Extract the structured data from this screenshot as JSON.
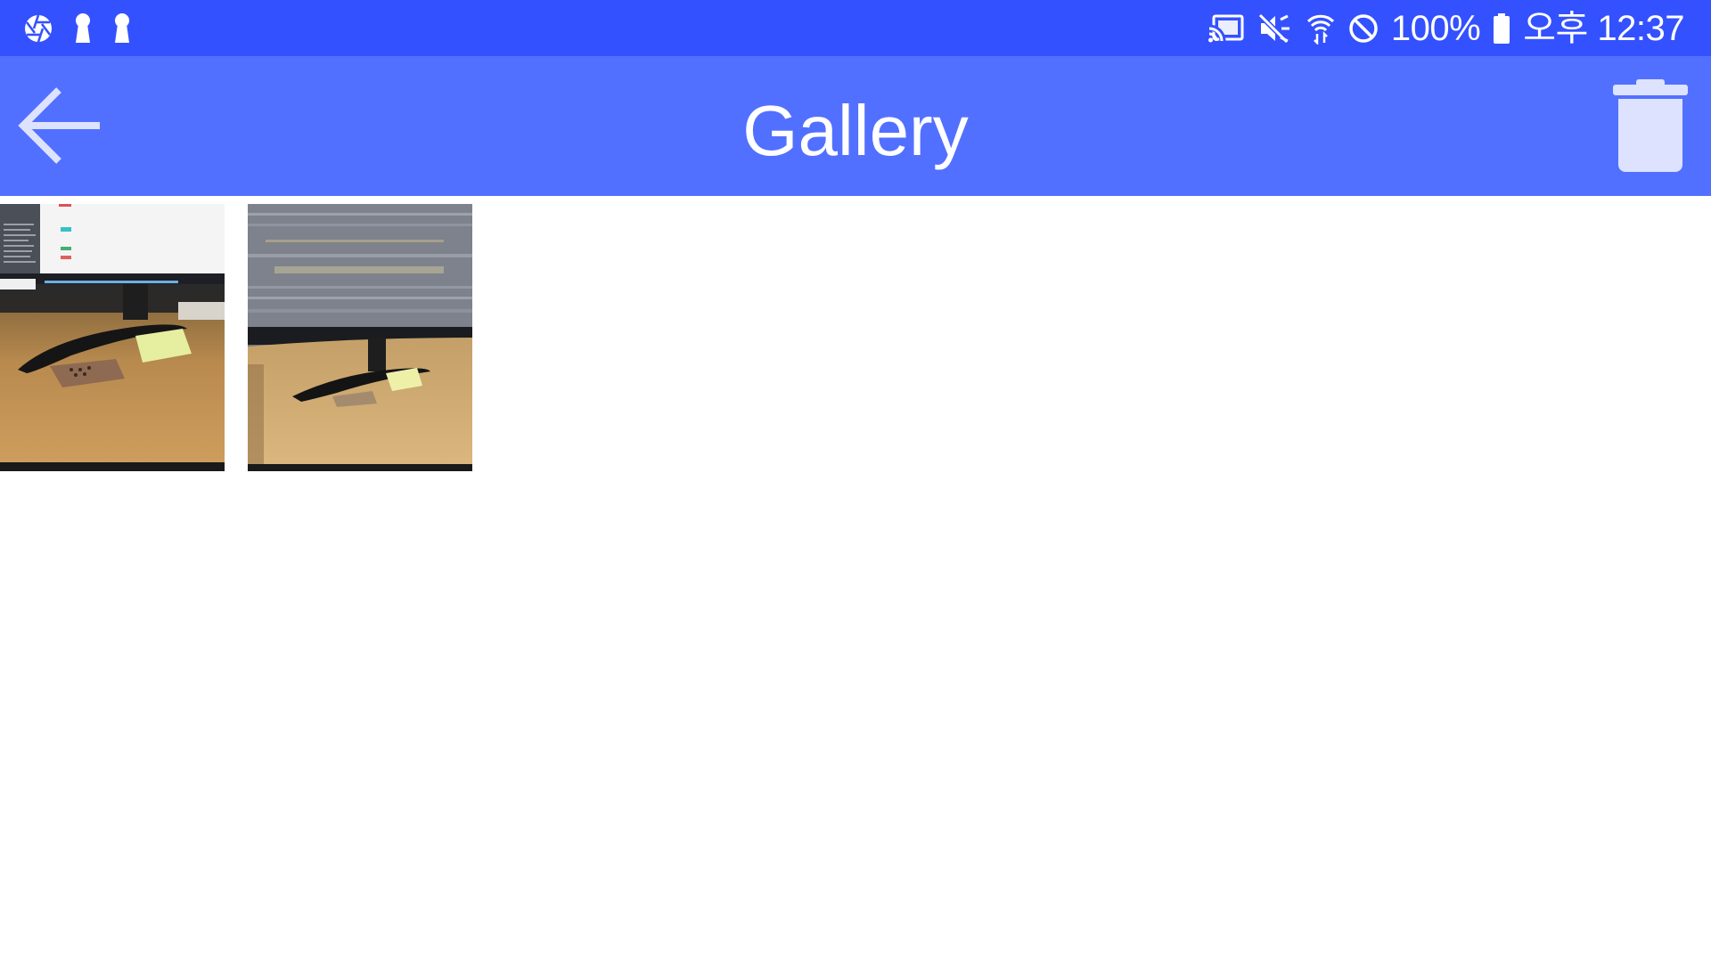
{
  "status_bar": {
    "battery_text": "100%",
    "time_text": "오후 12:37",
    "left_icons": [
      "camera-aperture-icon",
      "keyhole-icon",
      "keyhole-icon"
    ],
    "right_icons": [
      "screen-cast-icon",
      "mute-icon",
      "wifi-transfer-icon",
      "do-not-disturb-icon",
      "battery-icon"
    ]
  },
  "app_bar": {
    "title": "Gallery",
    "back_icon": "arrow-left-icon",
    "delete_icon": "trash-icon"
  },
  "gallery": {
    "items": [
      {
        "description": "photo-monitor-desk-1"
      },
      {
        "description": "photo-monitor-desk-2-blurred"
      }
    ]
  },
  "colors": {
    "status_bar": "#3451ff",
    "app_bar": "#5270ff",
    "icon_tint": "#dde2ff",
    "background": "#ffffff"
  }
}
